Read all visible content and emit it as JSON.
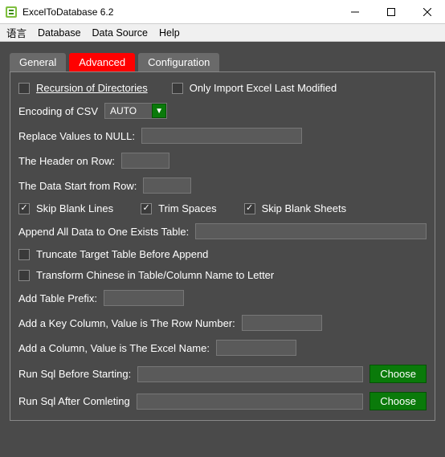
{
  "window": {
    "title": "ExcelToDatabase 6.2"
  },
  "menu": {
    "lang": "语言",
    "database": "Database",
    "datasource": "Data Source",
    "help": "Help"
  },
  "tabs": {
    "general": "General",
    "advanced": "Advanced",
    "configuration": "Configuration"
  },
  "labels": {
    "recursion": "Recursion of Directories",
    "only_last_modified": "Only Import Excel Last Modified",
    "encoding_csv": "Encoding of CSV",
    "replace_null": "Replace Values to NULL:",
    "header_row": "The Header on Row:",
    "data_start_row": "The Data Start from Row:",
    "skip_blank_lines": "Skip Blank Lines",
    "trim_spaces": "Trim Spaces",
    "skip_blank_sheets": "Skip Blank Sheets",
    "append_all": "Append All Data to One Exists Table:",
    "truncate": "Truncate Target Table Before Append",
    "transform_chinese": "Transform Chinese in Table/Column Name to Letter",
    "add_prefix": "Add Table Prefix:",
    "add_key_column": "Add a Key Column, Value is The Row Number:",
    "add_excel_column": "Add a Column, Value is The Excel Name:",
    "run_before": "Run Sql Before Starting:",
    "run_after": "Run Sql After Comleting"
  },
  "values": {
    "encoding": "AUTO",
    "replace_null": "",
    "header_row": "",
    "data_start_row": "",
    "append_table": "",
    "table_prefix": "",
    "key_column": "",
    "excel_column": "",
    "sql_before": "",
    "sql_after": ""
  },
  "buttons": {
    "choose": "Choose"
  },
  "checkboxes": {
    "recursion": false,
    "only_last_modified": false,
    "skip_blank_lines": true,
    "trim_spaces": true,
    "skip_blank_sheets": true,
    "truncate": false,
    "transform_chinese": false
  }
}
